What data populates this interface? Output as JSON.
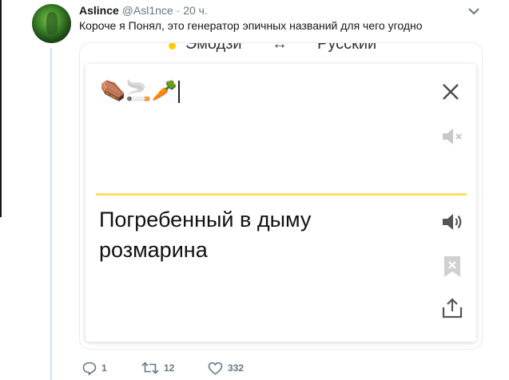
{
  "tweet": {
    "author_name": "Aslince",
    "handle": "@Asl1nce",
    "separator": "·",
    "time": "20 ч.",
    "text": "Короче я Понял, это генератор эпичных названий для чего угодно"
  },
  "translator": {
    "source_lang": "Эмодзи",
    "swap_symbol": "↔",
    "target_lang": "Русский",
    "input_emoji": "⚰️🚬🥕",
    "output_text": "Погребенный в дыму розмарина"
  },
  "actions": {
    "replies": "1",
    "retweets": "12",
    "likes": "332"
  },
  "colors": {
    "accent_yellow": "#ffdc60",
    "thread_line": "#c4e5f7",
    "muted_text": "#657786",
    "icon_gray": "#9aa0a6"
  },
  "icons": [
    "chevron-down-icon",
    "close-icon",
    "mute-icon",
    "speaker-icon",
    "bookmark-icon",
    "share-icon",
    "reply-icon",
    "retweet-icon",
    "like-icon"
  ]
}
